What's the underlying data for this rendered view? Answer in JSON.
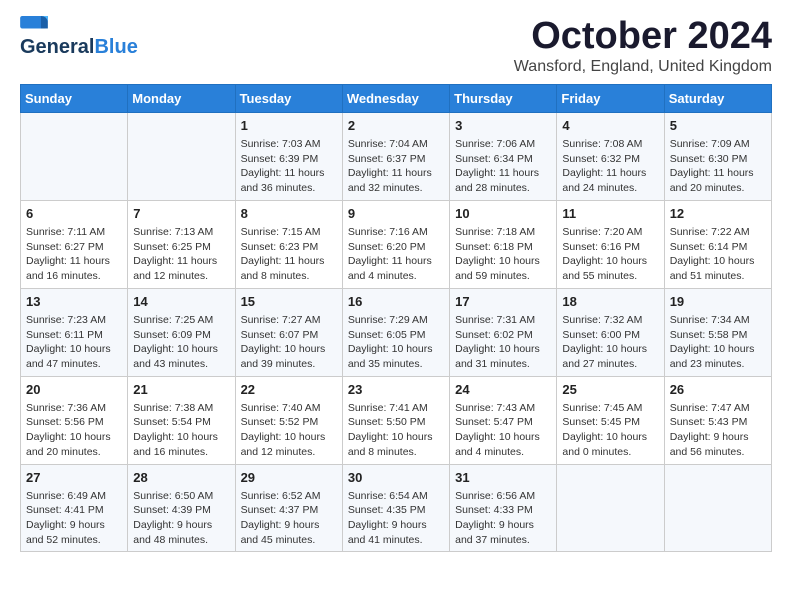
{
  "logo": {
    "line1": "General",
    "line2": "Blue"
  },
  "header": {
    "month": "October 2024",
    "location": "Wansford, England, United Kingdom"
  },
  "days_of_week": [
    "Sunday",
    "Monday",
    "Tuesday",
    "Wednesday",
    "Thursday",
    "Friday",
    "Saturday"
  ],
  "weeks": [
    [
      {
        "day": "",
        "info": ""
      },
      {
        "day": "",
        "info": ""
      },
      {
        "day": "1",
        "info": "Sunrise: 7:03 AM\nSunset: 6:39 PM\nDaylight: 11 hours and 36 minutes."
      },
      {
        "day": "2",
        "info": "Sunrise: 7:04 AM\nSunset: 6:37 PM\nDaylight: 11 hours and 32 minutes."
      },
      {
        "day": "3",
        "info": "Sunrise: 7:06 AM\nSunset: 6:34 PM\nDaylight: 11 hours and 28 minutes."
      },
      {
        "day": "4",
        "info": "Sunrise: 7:08 AM\nSunset: 6:32 PM\nDaylight: 11 hours and 24 minutes."
      },
      {
        "day": "5",
        "info": "Sunrise: 7:09 AM\nSunset: 6:30 PM\nDaylight: 11 hours and 20 minutes."
      }
    ],
    [
      {
        "day": "6",
        "info": "Sunrise: 7:11 AM\nSunset: 6:27 PM\nDaylight: 11 hours and 16 minutes."
      },
      {
        "day": "7",
        "info": "Sunrise: 7:13 AM\nSunset: 6:25 PM\nDaylight: 11 hours and 12 minutes."
      },
      {
        "day": "8",
        "info": "Sunrise: 7:15 AM\nSunset: 6:23 PM\nDaylight: 11 hours and 8 minutes."
      },
      {
        "day": "9",
        "info": "Sunrise: 7:16 AM\nSunset: 6:20 PM\nDaylight: 11 hours and 4 minutes."
      },
      {
        "day": "10",
        "info": "Sunrise: 7:18 AM\nSunset: 6:18 PM\nDaylight: 10 hours and 59 minutes."
      },
      {
        "day": "11",
        "info": "Sunrise: 7:20 AM\nSunset: 6:16 PM\nDaylight: 10 hours and 55 minutes."
      },
      {
        "day": "12",
        "info": "Sunrise: 7:22 AM\nSunset: 6:14 PM\nDaylight: 10 hours and 51 minutes."
      }
    ],
    [
      {
        "day": "13",
        "info": "Sunrise: 7:23 AM\nSunset: 6:11 PM\nDaylight: 10 hours and 47 minutes."
      },
      {
        "day": "14",
        "info": "Sunrise: 7:25 AM\nSunset: 6:09 PM\nDaylight: 10 hours and 43 minutes."
      },
      {
        "day": "15",
        "info": "Sunrise: 7:27 AM\nSunset: 6:07 PM\nDaylight: 10 hours and 39 minutes."
      },
      {
        "day": "16",
        "info": "Sunrise: 7:29 AM\nSunset: 6:05 PM\nDaylight: 10 hours and 35 minutes."
      },
      {
        "day": "17",
        "info": "Sunrise: 7:31 AM\nSunset: 6:02 PM\nDaylight: 10 hours and 31 minutes."
      },
      {
        "day": "18",
        "info": "Sunrise: 7:32 AM\nSunset: 6:00 PM\nDaylight: 10 hours and 27 minutes."
      },
      {
        "day": "19",
        "info": "Sunrise: 7:34 AM\nSunset: 5:58 PM\nDaylight: 10 hours and 23 minutes."
      }
    ],
    [
      {
        "day": "20",
        "info": "Sunrise: 7:36 AM\nSunset: 5:56 PM\nDaylight: 10 hours and 20 minutes."
      },
      {
        "day": "21",
        "info": "Sunrise: 7:38 AM\nSunset: 5:54 PM\nDaylight: 10 hours and 16 minutes."
      },
      {
        "day": "22",
        "info": "Sunrise: 7:40 AM\nSunset: 5:52 PM\nDaylight: 10 hours and 12 minutes."
      },
      {
        "day": "23",
        "info": "Sunrise: 7:41 AM\nSunset: 5:50 PM\nDaylight: 10 hours and 8 minutes."
      },
      {
        "day": "24",
        "info": "Sunrise: 7:43 AM\nSunset: 5:47 PM\nDaylight: 10 hours and 4 minutes."
      },
      {
        "day": "25",
        "info": "Sunrise: 7:45 AM\nSunset: 5:45 PM\nDaylight: 10 hours and 0 minutes."
      },
      {
        "day": "26",
        "info": "Sunrise: 7:47 AM\nSunset: 5:43 PM\nDaylight: 9 hours and 56 minutes."
      }
    ],
    [
      {
        "day": "27",
        "info": "Sunrise: 6:49 AM\nSunset: 4:41 PM\nDaylight: 9 hours and 52 minutes."
      },
      {
        "day": "28",
        "info": "Sunrise: 6:50 AM\nSunset: 4:39 PM\nDaylight: 9 hours and 48 minutes."
      },
      {
        "day": "29",
        "info": "Sunrise: 6:52 AM\nSunset: 4:37 PM\nDaylight: 9 hours and 45 minutes."
      },
      {
        "day": "30",
        "info": "Sunrise: 6:54 AM\nSunset: 4:35 PM\nDaylight: 9 hours and 41 minutes."
      },
      {
        "day": "31",
        "info": "Sunrise: 6:56 AM\nSunset: 4:33 PM\nDaylight: 9 hours and 37 minutes."
      },
      {
        "day": "",
        "info": ""
      },
      {
        "day": "",
        "info": ""
      }
    ]
  ]
}
